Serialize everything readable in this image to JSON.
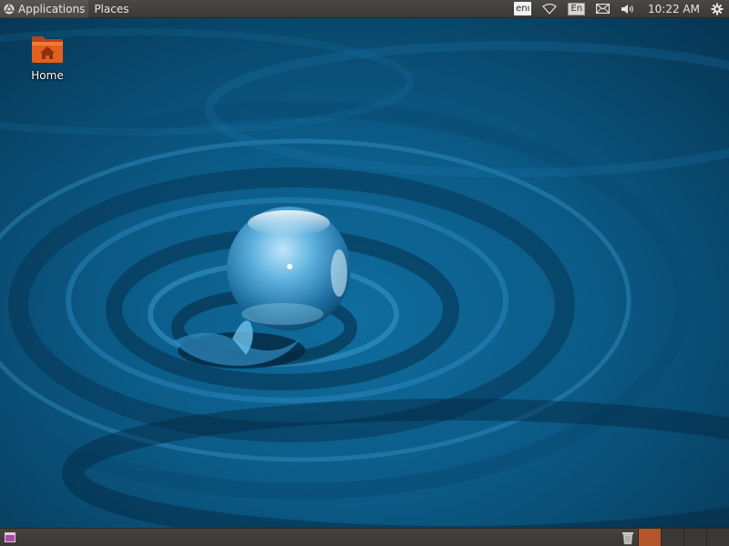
{
  "top_panel": {
    "applications_label": "Applications",
    "places_label": "Places",
    "keyboard_indicator": "enı",
    "language_indicator": "En",
    "clock": "10:22 AM"
  },
  "desktop": {
    "icons": [
      {
        "label": "Home"
      }
    ]
  },
  "bottom_panel": {
    "workspaces": [
      {
        "active": true
      },
      {
        "active": false
      },
      {
        "active": false
      },
      {
        "active": false
      }
    ]
  },
  "colors": {
    "panel": "#3c3b37",
    "workspace_active": "#b4552a",
    "folder_orange": "#e05a1a",
    "wallpaper_water": "#0b5f8e"
  },
  "icons": [
    "ubuntu-logo-icon",
    "wifi-icon",
    "mail-icon",
    "volume-icon",
    "settings-gear-icon",
    "home-folder-icon",
    "show-desktop-icon",
    "trash-icon"
  ]
}
